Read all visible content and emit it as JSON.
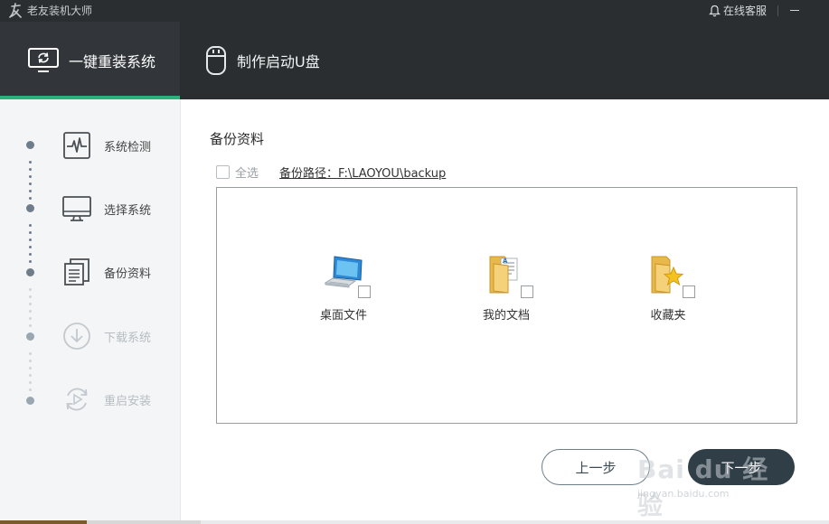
{
  "app": {
    "title": "老友装机大师",
    "support_label": "在线客服"
  },
  "tabs": [
    {
      "label": "一键重装系统",
      "icon": "monitor-refresh-icon",
      "active": true
    },
    {
      "label": "制作启动U盘",
      "icon": "usb-drive-icon",
      "active": false
    }
  ],
  "steps": [
    {
      "label": "系统检测",
      "icon": "pulse-monitor-icon",
      "state": "done"
    },
    {
      "label": "选择系统",
      "icon": "desktop-icon",
      "state": "done"
    },
    {
      "label": "备份资料",
      "icon": "documents-icon",
      "state": "current"
    },
    {
      "label": "下载系统",
      "icon": "download-icon",
      "state": "pending"
    },
    {
      "label": "重启安装",
      "icon": "restart-icon",
      "state": "pending"
    }
  ],
  "backup": {
    "title": "备份资料",
    "select_all_label": "全选",
    "path_label": "备份路径：F:\\LAOYOU\\backup",
    "items": [
      {
        "name": "桌面文件",
        "icon": "computer-icon",
        "checked": false
      },
      {
        "name": "我的文档",
        "icon": "documents-folder-icon",
        "checked": false
      },
      {
        "name": "收藏夹",
        "icon": "favorites-folder-icon",
        "checked": false
      }
    ]
  },
  "buttons": {
    "prev_label": "上一步",
    "next_label": "下一步"
  },
  "watermark": {
    "brand": "Bai du 经验",
    "url": "jingyan.baidu.com"
  },
  "colors": {
    "accent": "#2ab27b",
    "header_bg": "#2b2e31",
    "primary_button": "#2f3e47"
  }
}
